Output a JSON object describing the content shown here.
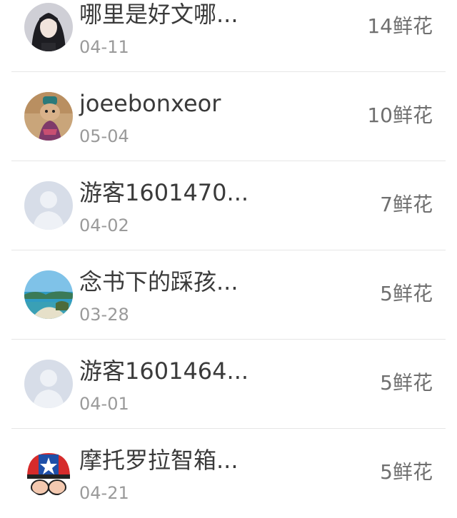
{
  "list": {
    "items": [
      {
        "name": "哪里是好文哪...",
        "date": "04-11",
        "flowers": "14鲜花",
        "avatar_icon": "avatar-girl-dark-hair-icon"
      },
      {
        "name": "joeebonxeor",
        "date": "05-04",
        "flowers": "10鲜花",
        "avatar_icon": "avatar-cat-costume-icon"
      },
      {
        "name": "游客1601470...",
        "date": "04-02",
        "flowers": "7鲜花",
        "avatar_icon": "avatar-default-person-icon"
      },
      {
        "name": "念书下的踩孩...",
        "date": "03-28",
        "flowers": "5鲜花",
        "avatar_icon": "avatar-seaside-landscape-icon"
      },
      {
        "name": "游客1601464...",
        "date": "04-01",
        "flowers": "5鲜花",
        "avatar_icon": "avatar-default-person-icon"
      },
      {
        "name": "摩托罗拉智箱...",
        "date": "04-21",
        "flowers": "5鲜花",
        "avatar_icon": "avatar-captain-star-cartoon-icon"
      }
    ]
  },
  "colors": {
    "name_text": "#3a3a3a",
    "date_text": "#9a9a9a",
    "count_text": "#6f6f6f",
    "divider": "#e6e6e6",
    "default_avatar_bg": "#d7dde8"
  }
}
